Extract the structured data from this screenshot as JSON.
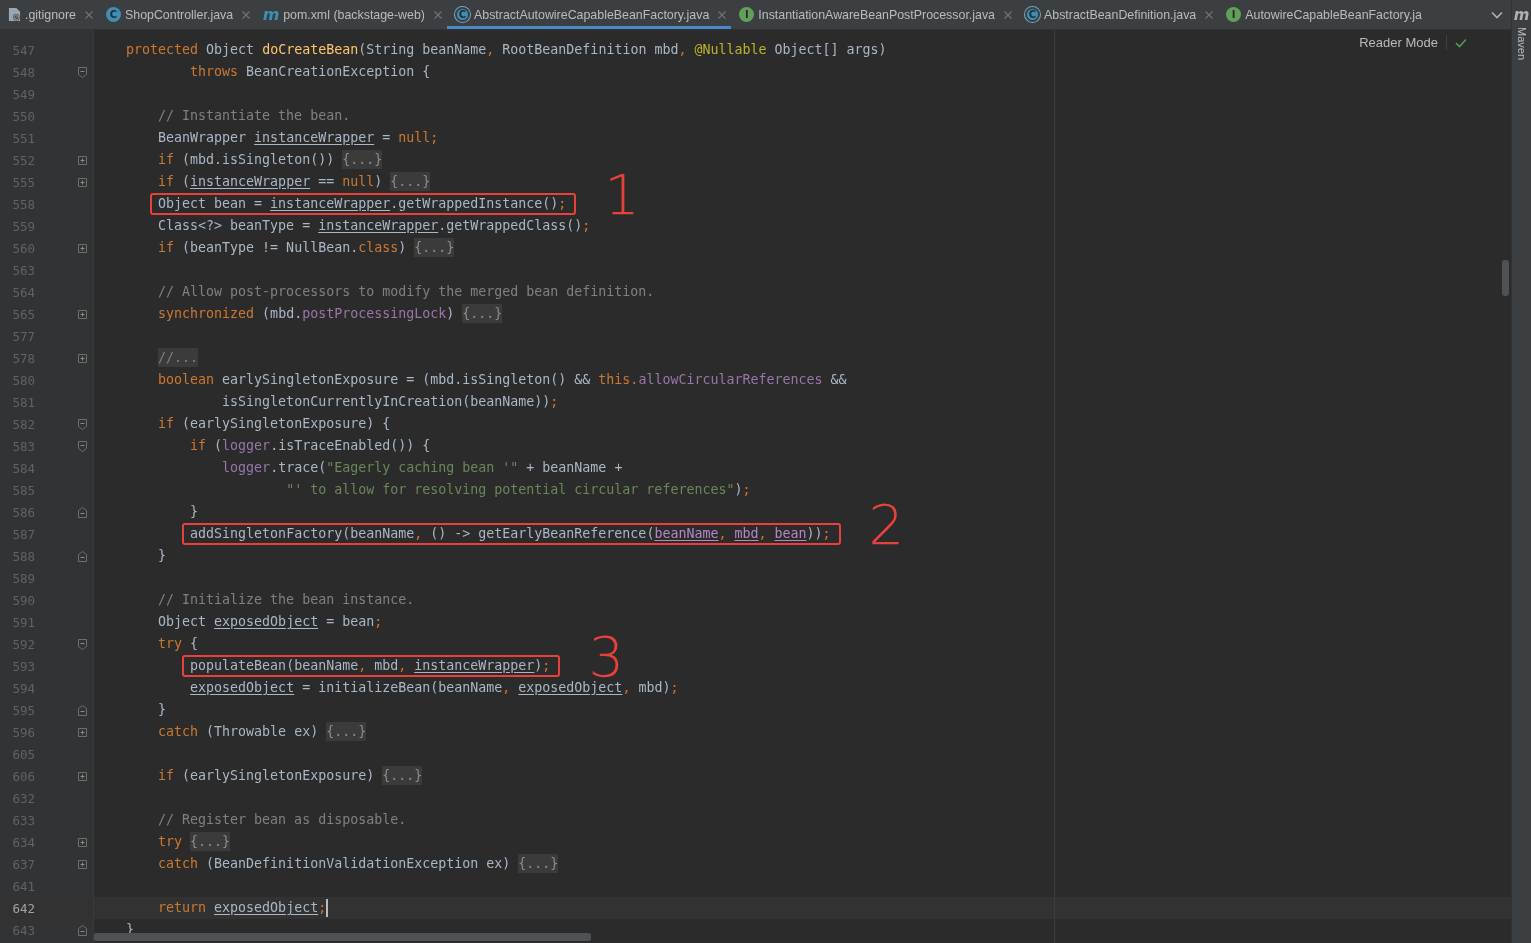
{
  "tabs": [
    {
      "label": ".gitignore",
      "kind": "git",
      "selected": false,
      "closable": true
    },
    {
      "label": "ShopController.java",
      "kind": "class",
      "icon_letter": "C",
      "selected": false,
      "closable": true
    },
    {
      "label": "pom.xml (backstage-web)",
      "kind": "maven",
      "icon_letter": "m",
      "selected": false,
      "closable": true
    },
    {
      "label": "AbstractAutowireCapableBeanFactory.java",
      "kind": "abstract",
      "icon_letter": "C",
      "selected": true,
      "closable": true
    },
    {
      "label": "InstantiationAwareBeanPostProcessor.java",
      "kind": "interface",
      "icon_letter": "I",
      "selected": false,
      "closable": true
    },
    {
      "label": "AbstractBeanDefinition.java",
      "kind": "abstract",
      "icon_letter": "C",
      "selected": false,
      "closable": true
    },
    {
      "label": "AutowireCapableBeanFactory.ja",
      "kind": "interface",
      "icon_letter": "I",
      "selected": false,
      "closable": false
    }
  ],
  "editor": {
    "reader_mode": "Reader Mode",
    "lines": [
      {
        "number": "547",
        "kind": "plain",
        "current": false,
        "tokens": [
          {
            "kind": "kw",
            "text": "    protected"
          },
          {
            "kind": "txt",
            "text": " Object "
          },
          {
            "kind": "decl",
            "text": "doCreateBean"
          },
          {
            "kind": "txt",
            "text": "(String beanName"
          },
          {
            "kind": "kw",
            "text": ", "
          },
          {
            "kind": "txt",
            "text": "RootBeanDefinition mbd"
          },
          {
            "kind": "kw",
            "text": ", "
          },
          {
            "kind": "ann",
            "text": "@Nullable"
          },
          {
            "kind": "txt",
            "text": " Object[] args)"
          }
        ]
      },
      {
        "number": "548",
        "kind": "fold-start",
        "current": false,
        "tokens": [
          {
            "kind": "kw",
            "text": "            throws"
          },
          {
            "kind": "txt",
            "text": " BeanCreationException {"
          }
        ]
      },
      {
        "number": "549",
        "kind": "plain",
        "current": false
      },
      {
        "number": "550",
        "kind": "plain",
        "current": false,
        "tokens": [
          {
            "kind": "com",
            "text": "        // Instantiate the bean."
          }
        ]
      },
      {
        "number": "551",
        "kind": "plain",
        "current": false,
        "tokens": [
          {
            "kind": "txt",
            "text": "        BeanWrapper "
          },
          {
            "kind": "var",
            "text": "instanceWrapper"
          },
          {
            "kind": "txt",
            "text": " = "
          },
          {
            "kind": "kw",
            "text": "null;"
          }
        ]
      },
      {
        "number": "552",
        "kind": "folded",
        "current": false,
        "tokens": [
          {
            "kind": "kw",
            "text": "        if"
          },
          {
            "kind": "txt",
            "text": " (mbd.isSingleton()) "
          },
          {
            "kind": "fold",
            "text": "{...}"
          }
        ]
      },
      {
        "number": "555",
        "kind": "folded",
        "current": false,
        "tokens": [
          {
            "kind": "kw",
            "text": "        if"
          },
          {
            "kind": "txt",
            "text": " ("
          },
          {
            "kind": "var",
            "text": "instanceWrapper"
          },
          {
            "kind": "txt",
            "text": " == "
          },
          {
            "kind": "kw",
            "text": "null"
          },
          {
            "kind": "txt",
            "text": ") "
          },
          {
            "kind": "fold",
            "text": "{...}"
          }
        ]
      },
      {
        "number": "558",
        "kind": "plain",
        "current": false,
        "callout": "1",
        "tokens": [
          {
            "kind": "txt",
            "text": "        Object bean = "
          },
          {
            "kind": "var",
            "text": "instanceWrapper"
          },
          {
            "kind": "txt",
            "text": ".getWrappedInstance()"
          },
          {
            "kind": "kw",
            "text": ";"
          }
        ]
      },
      {
        "number": "559",
        "kind": "plain",
        "current": false,
        "tokens": [
          {
            "kind": "txt",
            "text": "        Class<?> beanType = "
          },
          {
            "kind": "var",
            "text": "instanceWrapper"
          },
          {
            "kind": "txt",
            "text": ".getWrappedClass()"
          },
          {
            "kind": "kw",
            "text": ";"
          }
        ]
      },
      {
        "number": "560",
        "kind": "folded",
        "current": false,
        "tokens": [
          {
            "kind": "kw",
            "text": "        if"
          },
          {
            "kind": "txt",
            "text": " (beanType != NullBean."
          },
          {
            "kind": "kw",
            "text": "class"
          },
          {
            "kind": "txt",
            "text": ") "
          },
          {
            "kind": "fold",
            "text": "{...}"
          }
        ]
      },
      {
        "number": "563",
        "kind": "plain",
        "current": false
      },
      {
        "number": "564",
        "kind": "plain",
        "current": false,
        "tokens": [
          {
            "kind": "com",
            "text": "        // Allow post-processors to modify the merged bean definition."
          }
        ]
      },
      {
        "number": "565",
        "kind": "folded",
        "current": false,
        "tokens": [
          {
            "kind": "kw",
            "text": "        synchronized"
          },
          {
            "kind": "txt",
            "text": " (mbd."
          },
          {
            "kind": "fld",
            "text": "postProcessingLock"
          },
          {
            "kind": "txt",
            "text": ") "
          },
          {
            "kind": "fold",
            "text": "{...}"
          }
        ]
      },
      {
        "number": "577",
        "kind": "plain",
        "current": false
      },
      {
        "number": "578",
        "kind": "folded",
        "current": false,
        "tokens": [
          {
            "kind": "foldcom",
            "text": "        //..."
          }
        ]
      },
      {
        "number": "580",
        "kind": "plain",
        "current": false,
        "tokens": [
          {
            "kind": "kw",
            "text": "        boolean"
          },
          {
            "kind": "txt",
            "text": " earlySingletonExposure = (mbd.isSingleton() && "
          },
          {
            "kind": "kw",
            "text": "this."
          },
          {
            "kind": "fld",
            "text": "allowCircularReferences"
          },
          {
            "kind": "txt",
            "text": " &&"
          }
        ]
      },
      {
        "number": "581",
        "kind": "plain",
        "current": false,
        "tokens": [
          {
            "kind": "txt",
            "text": "                isSingletonCurrentlyInCreation(beanName))"
          },
          {
            "kind": "kw",
            "text": ";"
          }
        ]
      },
      {
        "number": "582",
        "kind": "fold-start",
        "current": false,
        "tokens": [
          {
            "kind": "kw",
            "text": "        if"
          },
          {
            "kind": "txt",
            "text": " (earlySingletonExposure) {"
          }
        ]
      },
      {
        "number": "583",
        "kind": "fold-start",
        "current": false,
        "tokens": [
          {
            "kind": "kw",
            "text": "            if"
          },
          {
            "kind": "txt",
            "text": " ("
          },
          {
            "kind": "fld",
            "text": "logger"
          },
          {
            "kind": "txt",
            "text": ".isTraceEnabled()) {"
          }
        ]
      },
      {
        "number": "584",
        "kind": "plain",
        "current": false,
        "tokens": [
          {
            "kind": "fld",
            "text": "                logger"
          },
          {
            "kind": "txt",
            "text": ".trace("
          },
          {
            "kind": "str",
            "text": "\"Eagerly caching bean '\""
          },
          {
            "kind": "txt",
            "text": " + beanName +"
          }
        ]
      },
      {
        "number": "585",
        "kind": "plain",
        "current": false,
        "tokens": [
          {
            "kind": "str",
            "text": "                        \"' to allow for resolving potential circular references\""
          },
          {
            "kind": "txt",
            "text": ")"
          },
          {
            "kind": "kw",
            "text": ";"
          }
        ]
      },
      {
        "number": "586",
        "kind": "fold-end",
        "current": false,
        "tokens": [
          {
            "kind": "txt",
            "text": "            }"
          }
        ]
      },
      {
        "number": "587",
        "kind": "plain",
        "current": false,
        "callout": "2",
        "tokens": [
          {
            "kind": "txt",
            "text": "            addSingletonFactory(beanName"
          },
          {
            "kind": "kw",
            "text": ", "
          },
          {
            "kind": "txt",
            "text": "() -> getEarlyBeanReference("
          },
          {
            "kind": "cap",
            "text": "beanName"
          },
          {
            "kind": "kw",
            "text": ", "
          },
          {
            "kind": "cap",
            "text": "mbd"
          },
          {
            "kind": "kw",
            "text": ", "
          },
          {
            "kind": "cap",
            "text": "bean"
          },
          {
            "kind": "txt",
            "text": "))"
          },
          {
            "kind": "kw",
            "text": ";"
          }
        ]
      },
      {
        "number": "588",
        "kind": "fold-end",
        "current": false,
        "tokens": [
          {
            "kind": "txt",
            "text": "        }"
          }
        ]
      },
      {
        "number": "589",
        "kind": "plain",
        "current": false
      },
      {
        "number": "590",
        "kind": "plain",
        "current": false,
        "tokens": [
          {
            "kind": "com",
            "text": "        // Initialize the bean instance."
          }
        ]
      },
      {
        "number": "591",
        "kind": "plain",
        "current": false,
        "tokens": [
          {
            "kind": "txt",
            "text": "        Object "
          },
          {
            "kind": "var",
            "text": "exposedObject"
          },
          {
            "kind": "txt",
            "text": " = bean"
          },
          {
            "kind": "kw",
            "text": ";"
          }
        ]
      },
      {
        "number": "592",
        "kind": "fold-start",
        "current": false,
        "tokens": [
          {
            "kind": "kw",
            "text": "        try"
          },
          {
            "kind": "txt",
            "text": " {"
          }
        ]
      },
      {
        "number": "593",
        "kind": "plain",
        "current": false,
        "callout": "3",
        "tokens": [
          {
            "kind": "txt",
            "text": "            populateBean(beanName"
          },
          {
            "kind": "kw",
            "text": ", "
          },
          {
            "kind": "txt",
            "text": "mbd"
          },
          {
            "kind": "kw",
            "text": ", "
          },
          {
            "kind": "var",
            "text": "instanceWrapper"
          },
          {
            "kind": "txt",
            "text": ")"
          },
          {
            "kind": "kw",
            "text": ";"
          }
        ]
      },
      {
        "number": "594",
        "kind": "plain",
        "current": false,
        "tokens": [
          {
            "kind": "var",
            "text": "            exposedObject"
          },
          {
            "kind": "txt",
            "text": " = initializeBean(beanName"
          },
          {
            "kind": "kw",
            "text": ", "
          },
          {
            "kind": "var",
            "text": "exposedObject"
          },
          {
            "kind": "kw",
            "text": ", "
          },
          {
            "kind": "txt",
            "text": "mbd)"
          },
          {
            "kind": "kw",
            "text": ";"
          }
        ]
      },
      {
        "number": "595",
        "kind": "fold-end",
        "current": false,
        "tokens": [
          {
            "kind": "txt",
            "text": "        }"
          }
        ]
      },
      {
        "number": "596",
        "kind": "folded",
        "current": false,
        "tokens": [
          {
            "kind": "kw",
            "text": "        catch"
          },
          {
            "kind": "txt",
            "text": " (Throwable ex) "
          },
          {
            "kind": "fold",
            "text": "{...}"
          }
        ]
      },
      {
        "number": "605",
        "kind": "plain",
        "current": false
      },
      {
        "number": "606",
        "kind": "folded",
        "current": false,
        "tokens": [
          {
            "kind": "kw",
            "text": "        if"
          },
          {
            "kind": "txt",
            "text": " (earlySingletonExposure) "
          },
          {
            "kind": "fold",
            "text": "{...}"
          }
        ]
      },
      {
        "number": "632",
        "kind": "plain",
        "current": false
      },
      {
        "number": "633",
        "kind": "plain",
        "current": false,
        "tokens": [
          {
            "kind": "com",
            "text": "        // Register bean as disposable."
          }
        ]
      },
      {
        "number": "634",
        "kind": "folded",
        "current": false,
        "tokens": [
          {
            "kind": "kw",
            "text": "        try "
          },
          {
            "kind": "fold",
            "text": "{...}"
          }
        ]
      },
      {
        "number": "637",
        "kind": "folded",
        "current": false,
        "tokens": [
          {
            "kind": "kw",
            "text": "        catch"
          },
          {
            "kind": "txt",
            "text": " (BeanDefinitionValidationException ex) "
          },
          {
            "kind": "fold",
            "text": "{...}"
          }
        ]
      },
      {
        "number": "641",
        "kind": "plain",
        "current": false
      },
      {
        "number": "642",
        "kind": "plain",
        "current": true,
        "tokens": [
          {
            "kind": "kw",
            "text": "        return "
          },
          {
            "kind": "var",
            "text": "exposedObject"
          },
          {
            "kind": "kw",
            "text": ";"
          }
        ]
      },
      {
        "number": "643",
        "kind": "fold-end",
        "current": false,
        "tokens": [
          {
            "kind": "txt",
            "text": "    }"
          }
        ]
      }
    ]
  },
  "tool_window": {
    "icon_letter": "m",
    "label": "Maven"
  }
}
